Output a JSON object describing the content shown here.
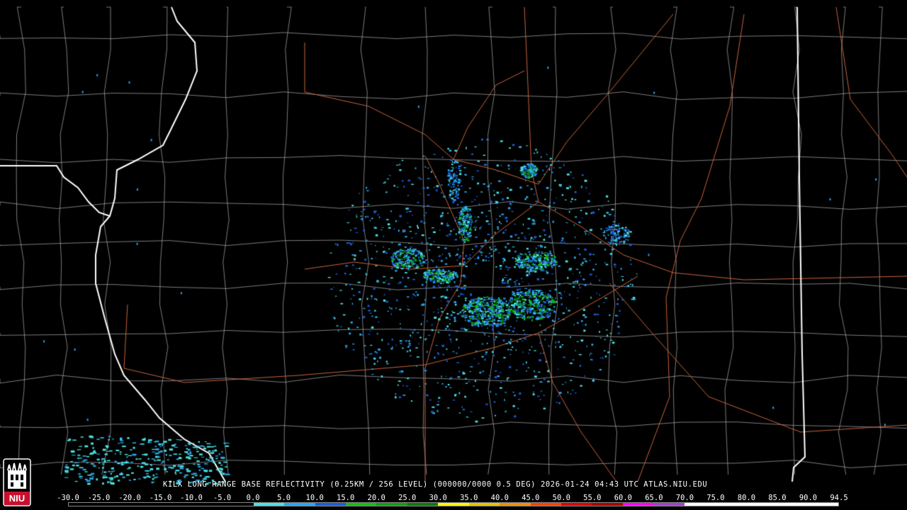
{
  "caption": "KILX LONG RANGE BASE REFLECTIVITY (0.25KM / 256 LEVEL) (000000/0000 0.5 DEG) 2026-01-24 04:43 UTC  ATLAS.NIU.EDU",
  "logo_text": "NIU",
  "colors": {
    "background": "#000000",
    "county_lines": "#bdbdbd",
    "state_lines": "#ffffff",
    "roads": "#c8643c",
    "logo_red": "#c8102e"
  },
  "scale": {
    "labels": [
      "-30.0",
      "-25.0",
      "-20.0",
      "-15.0",
      "-10.0",
      "-5.0",
      "0.0",
      "5.0",
      "10.0",
      "15.0",
      "20.0",
      "25.0",
      "30.0",
      "35.0",
      "40.0",
      "45.0",
      "50.0",
      "55.0",
      "60.0",
      "65.0",
      "70.0",
      "75.0",
      "80.0",
      "85.0",
      "90.0",
      "94.5"
    ],
    "colors": [
      "#000000",
      "#000000",
      "#000000",
      "#000000",
      "#000000",
      "#000000",
      "#4ce0e0",
      "#2aa5ee",
      "#1a5cd8",
      "#10c010",
      "#0ea00e",
      "#0a7a0a",
      "#f8f800",
      "#e6c400",
      "#f09000",
      "#ff4000",
      "#e00000",
      "#b00000",
      "#ff00ff",
      "#a040d0",
      "#ffffff",
      "#ffffff",
      "#ffffff",
      "#ffffff",
      "#ffffff"
    ]
  }
}
